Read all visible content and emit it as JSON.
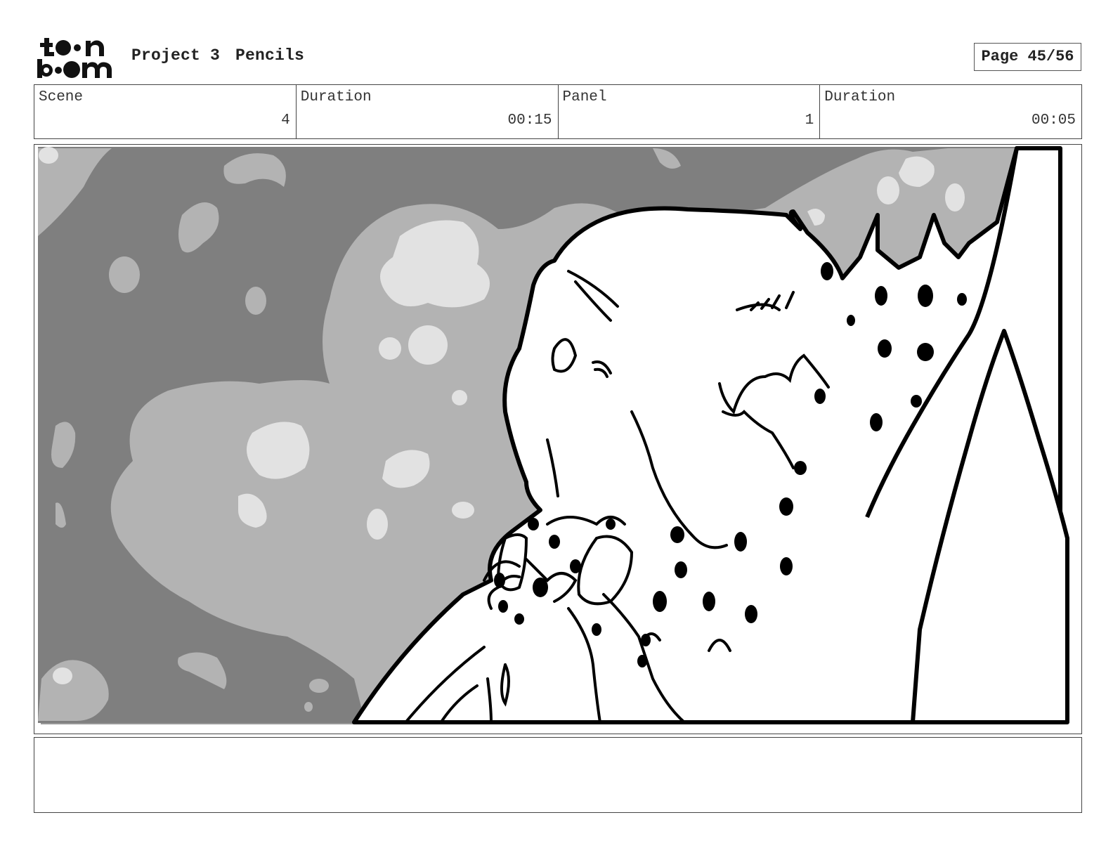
{
  "header": {
    "logo_text": "toon boom",
    "project_name": "Project 3",
    "stage": "Pencils",
    "page": "Page 45/56"
  },
  "info": {
    "scene_label": "Scene",
    "scene_value": "4",
    "scene_duration_label": "Duration",
    "scene_duration_value": "00:15",
    "panel_label": "Panel",
    "panel_value": "1",
    "panel_duration_label": "Duration",
    "panel_duration_value": "00:05"
  },
  "notes": {
    "text": ""
  },
  "colors": {
    "sky_dark": "#7f7f7f",
    "cloud_mid": "#b3b3b3",
    "cloud_light": "#e2e2e2",
    "ink": "#000000"
  }
}
